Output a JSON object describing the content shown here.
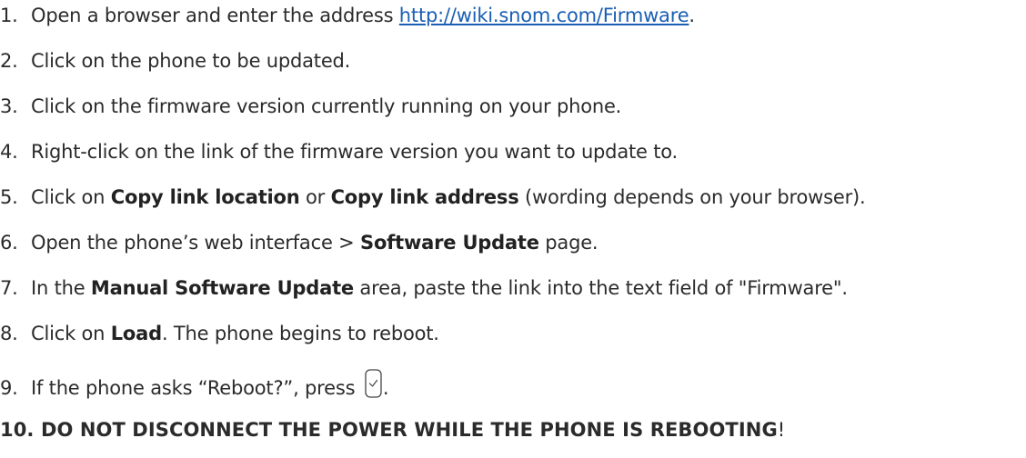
{
  "steps": [
    {
      "num": "1.",
      "pre": "Open a browser and enter the address ",
      "link": "http://wiki.snom.com/Firmware",
      "post": "."
    },
    {
      "num": "2.",
      "text": "Click on the phone to be updated."
    },
    {
      "num": "3.",
      "text": "Click on the firmware version currently running on your phone."
    },
    {
      "num": "4.",
      "text": "Right-click on the link of the firmware version you want to update to."
    },
    {
      "num": "5.",
      "pre": "Click on ",
      "b1": "Copy link location",
      "mid": " or ",
      "b2": "Copy link address",
      "post": " (wording depends on your browser)."
    },
    {
      "num": "6.",
      "pre": "Open the phone’s web interface > ",
      "b1": "Software Update",
      "post": " page."
    },
    {
      "num": "7.",
      "pre": "In the ",
      "b1": "Manual Software Update",
      "post": " area, paste the link into the text field of \"Firmware\"."
    },
    {
      "num": "8.",
      "pre": "Click on ",
      "b1": "Load",
      "post": ".  The phone begins to reboot."
    },
    {
      "num": "9.",
      "pre": "If the phone asks “Reboot?”, press ",
      "icon": "checkmark-key-icon",
      "post": "."
    },
    {
      "num": "10.",
      "bold": "DO NOT DISCONNECT THE POWER WHILE THE PHONE IS REBOOTING",
      "post": "!"
    }
  ]
}
